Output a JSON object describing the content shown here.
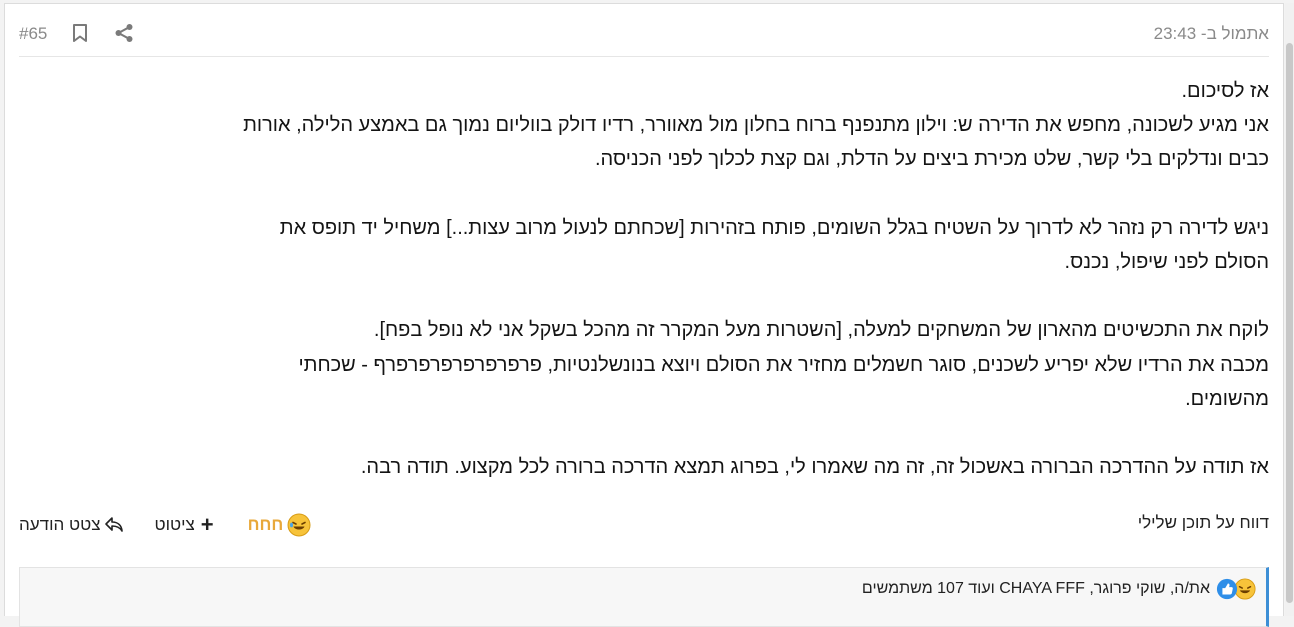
{
  "post": {
    "date": "אתמול ב- 23:43",
    "number": "#65",
    "paragraphs": [
      [
        "אז לסיכום.",
        "אני מגיע לשכונה, מחפש את הדירה ש: וילון מתנפנף ברוח בחלון מול מאוורר, רדיו דולק בווליום נמוך גם באמצע הלילה, אורות",
        "כבים ונדלקים בלי קשר, שלט מכירת ביצים על הדלת, וגם קצת לכלוך לפני הכניסה."
      ],
      [
        "ניגש לדירה רק נזהר לא לדרוך על השטיח בגלל השומים, פותח בזהירות [שכחתם לנעול מרוב עצות...] משחיל יד תופס את",
        "הסולם לפני שיפול, נכנס."
      ],
      [
        "לוקח את התכשיטים מהארון של המשחקים למעלה, [השטרות מעל המקרר זה מהכל בשקל אני לא נופל בפח].",
        "מכבה את הרדיו שלא יפריע לשכנים, סוגר חשמלים מחזיר את הסולם ויוצא בנונשלנטיות, פרפרפרפרפרפרפרף - שכחתי",
        "מהשומים."
      ],
      [
        "אז תודה על ההדרכה הברורה באשכול זה, זה מה שאמרו לי, בפרוג תמצא הדרכה ברורה לכל מקצוע. תודה רבה."
      ]
    ]
  },
  "icons": {
    "share": "share-icon",
    "bookmark": "bookmark-icon",
    "laugh": "laughing-emoji-icon",
    "like": "like-emoji-icon"
  },
  "actions": {
    "report": "דווח על תוכן שלילי",
    "react": "חחח",
    "quote": "ציטוט",
    "chat_quote": "צטט הודעה"
  },
  "reactions": {
    "summary": "את/ה, שוקי פרוגר, CHAYA FFF ועוד 107 משתמשים"
  },
  "colors": {
    "accent": "#3d8fd6",
    "react": "#e8a83a",
    "meta": "#8a8a8a"
  }
}
